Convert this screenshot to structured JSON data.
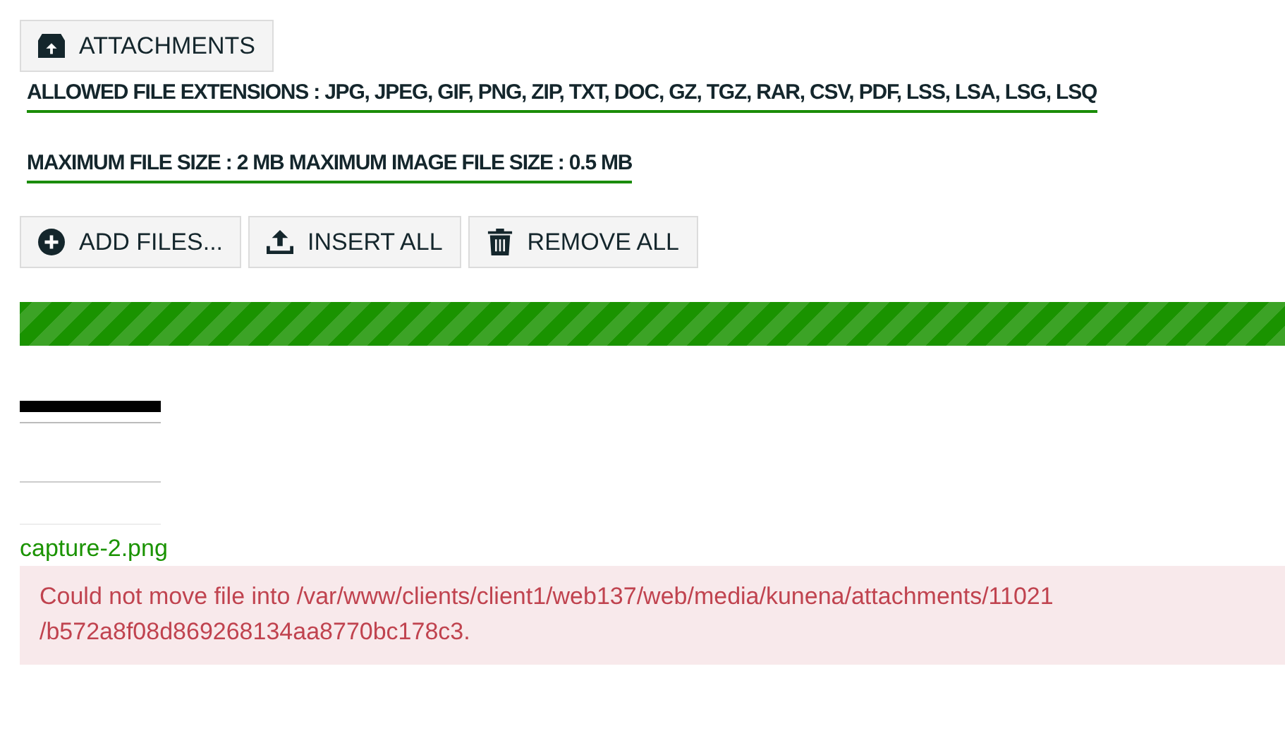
{
  "attachments_button": {
    "label": "ATTACHMENTS"
  },
  "info_lines": [
    "ALLOWED FILE EXTENSIONS : JPG, JPEG, GIF, PNG, ZIP, TXT, DOC, GZ, TGZ, RAR, CSV, PDF, LSS, LSA, LSG, LSQ",
    "MAXIMUM FILE SIZE : 2 MB MAXIMUM IMAGE FILE SIZE : 0.5 MB"
  ],
  "buttons": [
    {
      "label": "ADD FILES...",
      "kind": "add"
    },
    {
      "label": "INSERT ALL",
      "kind": "insert"
    },
    {
      "label": "REMOVE ALL",
      "kind": "remove"
    }
  ],
  "progress": {
    "level": 1
  },
  "file": {
    "name": "capture-2.png",
    "error_lines": [
      "Could not move file into /var/www/clients/client1/web137/web/media/kunena/attachments/11021",
      "/b572a8f08d869268134aa8770bc178c3."
    ]
  }
}
